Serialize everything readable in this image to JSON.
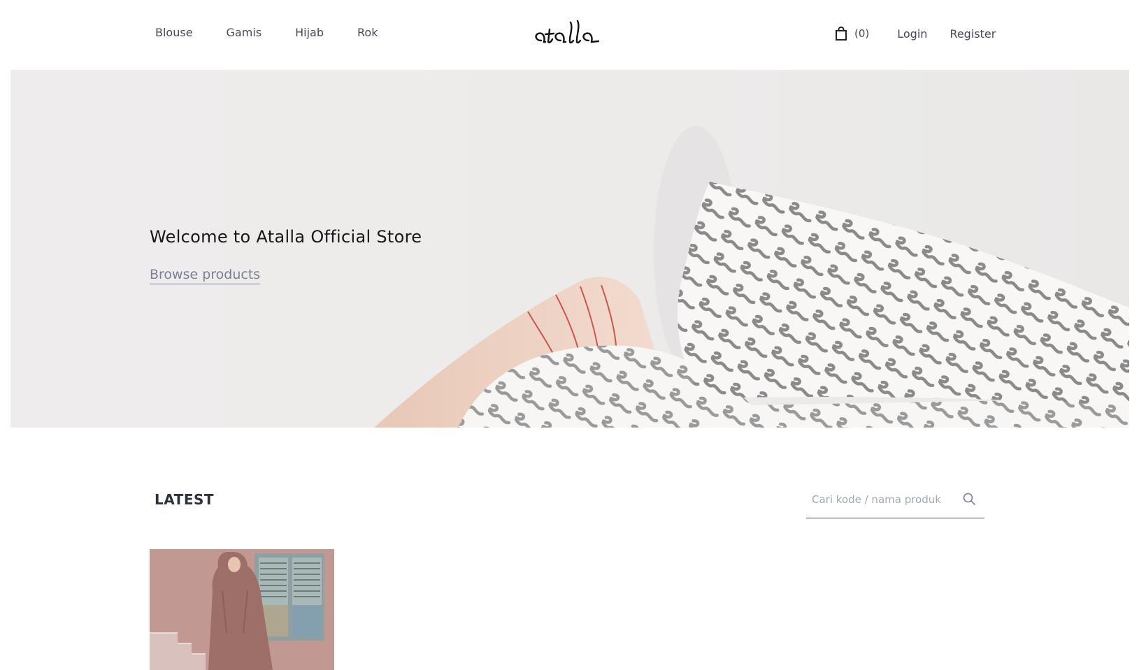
{
  "header": {
    "nav": [
      {
        "label": "Blouse"
      },
      {
        "label": "Gamis"
      },
      {
        "label": "Hijab"
      },
      {
        "label": "Rok"
      }
    ],
    "logo_text": "atalla",
    "cart": {
      "icon": "shopping-bag-icon",
      "count_label": "(0)"
    },
    "login_label": "Login",
    "register_label": "Register"
  },
  "hero": {
    "title": "Welcome to Atalla Official Store",
    "link_label": "Browse products"
  },
  "latest": {
    "title": "LATEST",
    "search": {
      "placeholder": "Cari kode / nama produk",
      "value": "",
      "icon": "search-icon"
    }
  },
  "colors": {
    "hero_bg": "#efeded",
    "text_dark": "#16181c",
    "link_muted": "#7a8095",
    "product_tone": "#b98a83"
  }
}
